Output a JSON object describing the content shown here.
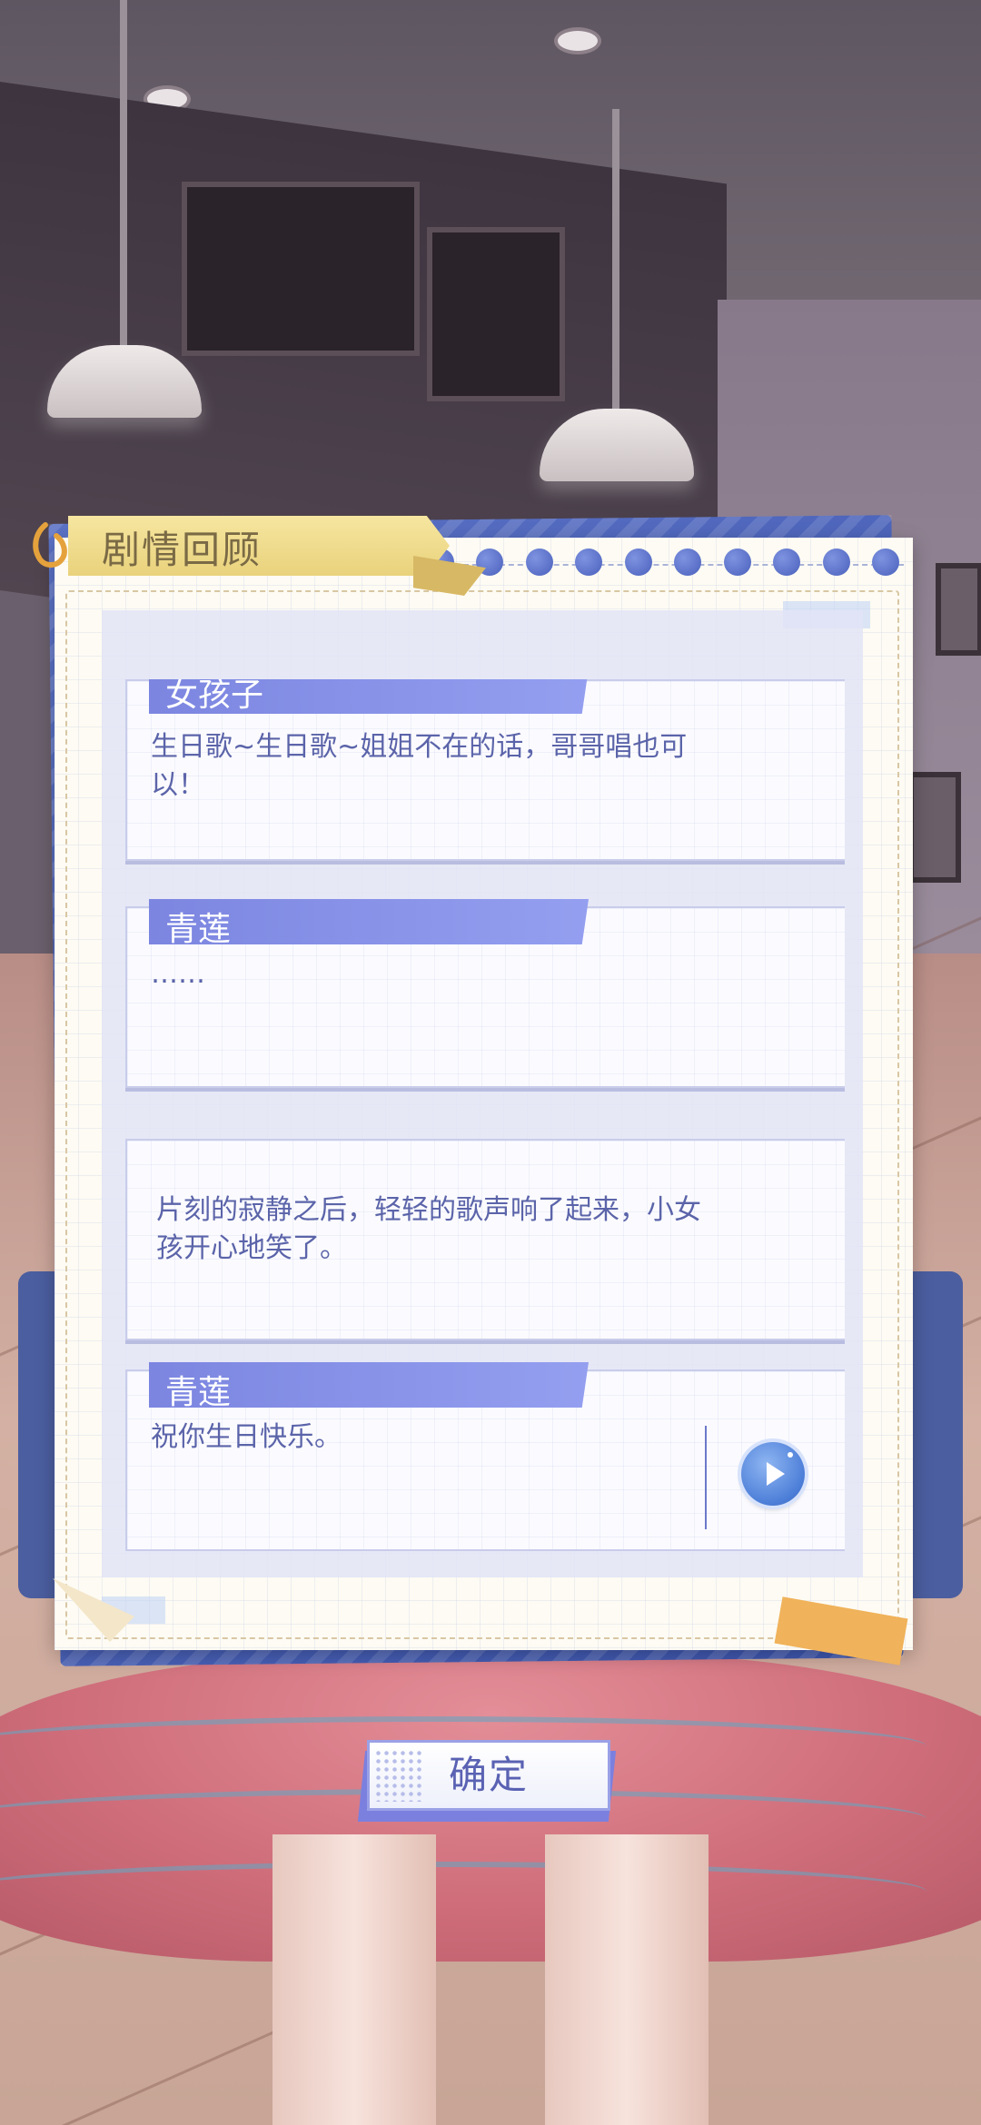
{
  "panel": {
    "title": "剧情回顾"
  },
  "dialogue": [
    {
      "speaker": "女孩子",
      "text": "生日歌~生日歌~姐姐不在的话，哥哥唱也可以！",
      "voice": false
    },
    {
      "speaker": "青莲",
      "text": "……",
      "voice": false
    },
    {
      "speaker": "",
      "text": "片刻的寂静之后，轻轻的歌声响了起来，小女孩开心地笑了。",
      "voice": false
    },
    {
      "speaker": "青莲",
      "text": "祝你生日快乐。",
      "voice": true
    }
  ],
  "buttons": {
    "confirm_label": "确定"
  },
  "icons": {
    "title_clip": "paperclip-icon",
    "play": "play-voice-icon"
  },
  "colors": {
    "accent": "#7c86e0",
    "panel_blue": "#4a60bc",
    "text_blue": "#5b64a9",
    "ribbon_gold": "#e9d27c"
  }
}
